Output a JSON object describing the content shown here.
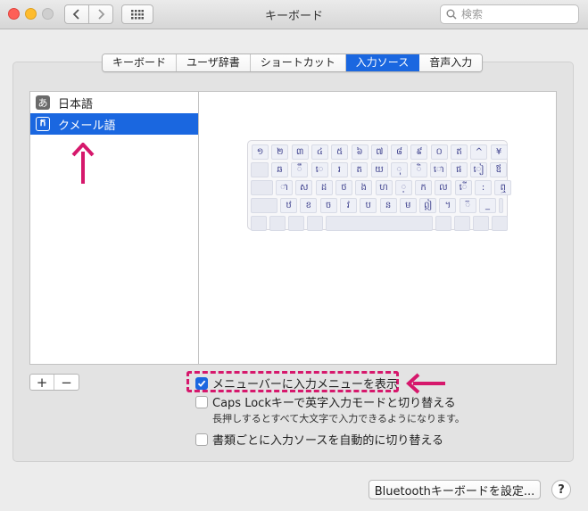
{
  "window": {
    "title": "キーボード"
  },
  "search": {
    "placeholder": "検索"
  },
  "tabs": [
    {
      "label": "キーボード"
    },
    {
      "label": "ユーザ辞書"
    },
    {
      "label": "ショートカット"
    },
    {
      "label": "入力ソース"
    },
    {
      "label": "音声入力"
    }
  ],
  "active_tab": "入力ソース",
  "sources": [
    {
      "icon": "あ",
      "label": "日本語",
      "selected": false
    },
    {
      "icon": "ក",
      "label": "クメール語",
      "selected": true
    }
  ],
  "list_controls": {
    "add": "+",
    "remove": "−"
  },
  "keyboard_rows": [
    [
      "១",
      "២",
      "៣",
      "៤",
      "៥",
      "៦",
      "៧",
      "៨",
      "៩",
      "០",
      "ឥ",
      "^",
      "¥"
    ],
    [
      "ឆ",
      "ឹ",
      "េ",
      "រ",
      "ត",
      "យ",
      "ុ",
      "ិ",
      "ោ",
      "ផ",
      "ៀ",
      "ឪ"
    ],
    [
      "ា",
      "ស",
      "ដ",
      "ថ",
      "ង",
      "ហ",
      "្",
      "ក",
      "ល",
      "ើ",
      ":",
      "ឮ"
    ],
    [
      "ឋ",
      "ខ",
      "ច",
      "វ",
      "ប",
      "ន",
      "ម",
      "ឦ",
      "។",
      "៊",
      "_"
    ]
  ],
  "options": {
    "show_menu": {
      "label": "メニューバーに入力メニューを表示",
      "checked": true
    },
    "caps_lock": {
      "label": "Caps Lockキーで英字入力モードと切り替える",
      "checked": false,
      "note": "長押しするとすべて大文字で入力できるようになります。"
    },
    "auto_switch": {
      "label": "書類ごとに入力ソースを自動的に切り替える",
      "checked": false
    }
  },
  "buttons": {
    "bluetooth": "Bluetoothキーボードを設定...",
    "help": "?"
  },
  "colors": {
    "accent": "#1a67e0",
    "annotation": "#d6186c"
  }
}
